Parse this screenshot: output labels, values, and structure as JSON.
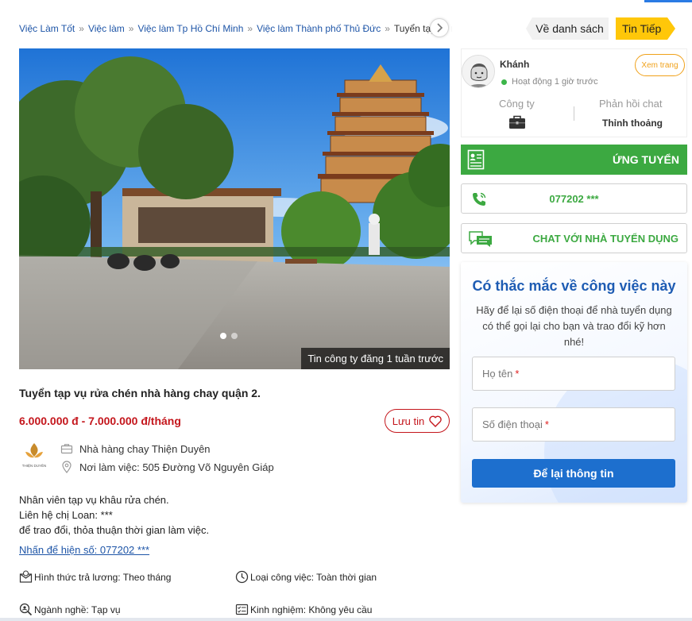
{
  "breadcrumb": {
    "items": [
      "Việc Làm Tốt",
      "Việc làm",
      "Việc làm Tp Hồ Chí Minh",
      "Việc làm Thành phố Thủ Đức"
    ],
    "current": "Tuyển tạp vụ rửa cl",
    "separator": "»"
  },
  "nav": {
    "back_label": "Về danh sách",
    "next_label": "Tin Tiếp"
  },
  "photo": {
    "caption": "Tin công ty đăng 1 tuần trước",
    "slide_count": 2,
    "active_slide": 1
  },
  "job": {
    "title": "Tuyển tạp vụ rửa chén nhà hàng chay quận 2.",
    "salary": "6.000.000 đ - 7.000.000 đ/tháng",
    "save_label": "Lưu tin",
    "company": "Nhà hàng chay Thiện Duyên",
    "location": "Nơi làm việc: 505 Đường Võ Nguyên Giáp",
    "logo_text": "THIỆN DUYÊN",
    "description": [
      "Nhân viên tạp vụ khâu rửa chén.",
      "Liên hệ chị Loan: ***",
      "để trao đổi, thỏa thuận thời gian làm việc."
    ],
    "phone_reveal": "Nhấn để hiện số: 077202 ***",
    "attributes": {
      "pay_type": "Hình thức trả lương: Theo tháng",
      "job_type": "Loại công việc: Toàn thời gian",
      "industry": "Ngành nghề: Tạp vụ",
      "experience": "Kinh nghiệm: Không yêu cầu"
    }
  },
  "employer": {
    "name": "Khánh",
    "status": "Hoạt động 1 giờ trước",
    "view_page": "Xem trang",
    "type_label": "Công ty",
    "reply_label": "Phản hồi chat",
    "reply_value": "Thỉnh thoảng"
  },
  "actions": {
    "apply": "ỨNG TUYỂN",
    "phone": "077202 ***",
    "chat": "CHAT VỚI NHÀ TUYỂN DỤNG"
  },
  "question": {
    "title": "Có thắc mắc về công việc này",
    "subtitle": "Hãy để lại số điện thoại để nhà tuyển dụng có thể gọi lại cho bạn và trao đổi kỹ hơn nhé!",
    "name_placeholder": "Họ tên",
    "phone_placeholder": "Số điện thoại",
    "required_mark": "*",
    "submit": "Để lại thông tin"
  },
  "colors": {
    "green": "#3ca941",
    "red": "#c4161c",
    "blue": "#1d6fce",
    "yellow": "#ffc709",
    "link": "#1e55a7"
  }
}
